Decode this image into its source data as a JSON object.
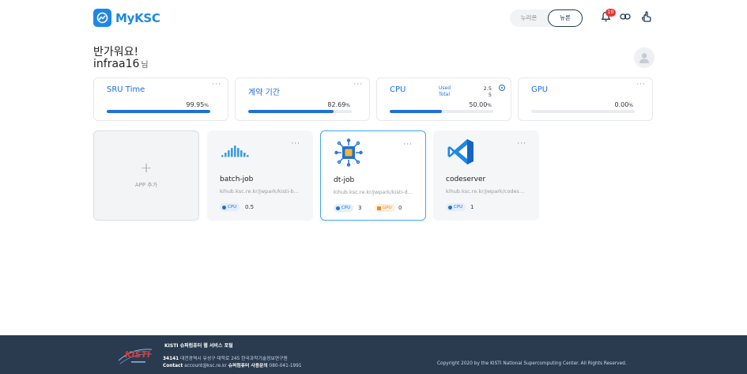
{
  "header": {
    "logo_text": "MyKSC",
    "toggle": {
      "option_a": "누리온",
      "option_b": "뉴론",
      "selected": "뉴론"
    },
    "notification_count": "10",
    "icons": [
      "bell-icon",
      "link-icon",
      "hand-cursor-icon"
    ]
  },
  "greeting": {
    "line1": "반가워요!",
    "username": "infraa16",
    "suffix": "님"
  },
  "stats": [
    {
      "title": "SRU Time",
      "value": "99.95",
      "unit": "%",
      "fill": 0.9995
    },
    {
      "title": "계약 기간",
      "value": "82.69",
      "unit": "%",
      "fill": 0.8269
    },
    {
      "title": "CPU",
      "used_label": "Used",
      "total_label": "Total",
      "used": "2.5",
      "total": "5",
      "value": "50.00",
      "unit": "%",
      "fill": 0.5
    },
    {
      "title": "GPU",
      "value": "0.00",
      "unit": "%",
      "fill": 0
    }
  ],
  "apps": {
    "add_label": "APP 추가",
    "more_glyph": "···",
    "items": [
      {
        "name": "batch-job",
        "url": "kihub.ksc.re.kr/jwpark/kisti-batch-job",
        "cpu_label": "CPU",
        "cpu": "0.5",
        "icon": "batch-job-icon"
      },
      {
        "name": "dt-job",
        "url": "kihub.ksc.re.kr/jwpark/kisti-dt-job",
        "cpu_label": "CPU",
        "cpu": "3",
        "gpu_label": "GPU",
        "gpu": "0",
        "icon": "chip-icon",
        "selected": true
      },
      {
        "name": "codeserver",
        "url": "kihub.ksc.re.kr/jwpark/codeserver",
        "cpu_label": "CPU",
        "cpu": "1",
        "icon": "vscode-icon"
      }
    ]
  },
  "footer": {
    "portal_title": "KISTI 슈퍼컴퓨터 웹 서비스 포털",
    "zip": "34141",
    "address": "대전광역시 유성구 대학로 245 한국과학기술정보연구원",
    "contact_label": "Contact",
    "email": "account@ksc.re.kr",
    "inquiry_label": "슈퍼컴퓨터 사용문의",
    "phone": "080-041-1991",
    "copyright": "Copyright 2020 by the KISTI National Supercomputing Center. All Rights Reserved."
  }
}
